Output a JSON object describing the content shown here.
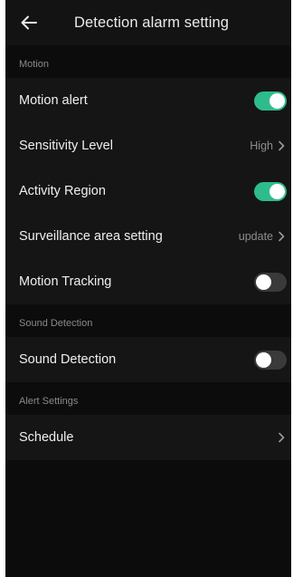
{
  "header": {
    "title": "Detection alarm setting",
    "back_icon": "arrow-left-icon"
  },
  "sections": {
    "motion": {
      "header": "Motion",
      "motion_alert": {
        "label": "Motion alert",
        "enabled": true
      },
      "sensitivity": {
        "label": "Sensitivity Level",
        "value": "High"
      },
      "activity_region": {
        "label": "Activity Region",
        "enabled": true
      },
      "surveillance_area": {
        "label": "Surveillance area setting",
        "value": "update"
      },
      "motion_tracking": {
        "label": "Motion Tracking",
        "enabled": false
      }
    },
    "sound": {
      "header": "Sound Detection",
      "sound_detection": {
        "label": "Sound Detection",
        "enabled": false
      }
    },
    "alert": {
      "header": "Alert Settings",
      "schedule": {
        "label": "Schedule"
      }
    }
  },
  "colors": {
    "toggle_on": "#2ebc8d",
    "toggle_off": "#3a3a3a",
    "background": "#0c0c0c",
    "row_background": "#151515"
  }
}
